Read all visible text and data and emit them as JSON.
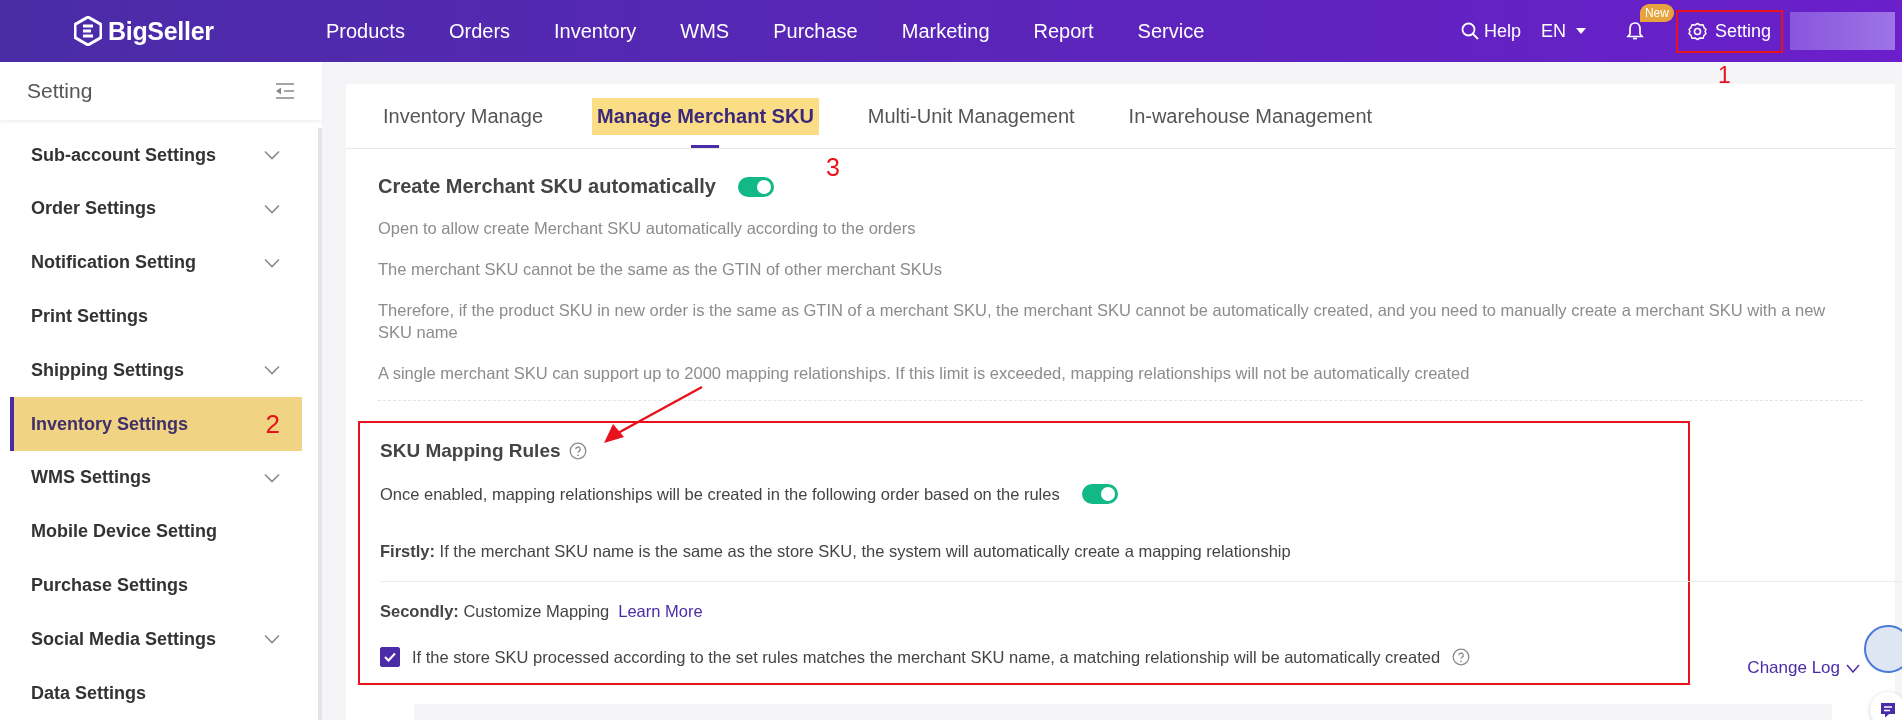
{
  "header": {
    "logo": "BigSeller",
    "nav": [
      "Products",
      "Orders",
      "Inventory",
      "WMS",
      "Purchase",
      "Marketing",
      "Report",
      "Service"
    ],
    "help": "Help",
    "language": "EN",
    "notification_badge": "New",
    "setting": {
      "label": "Setting",
      "highlighted": true,
      "annotation": "1"
    }
  },
  "sidebar": {
    "title": "Setting",
    "items": [
      {
        "label": "Sub-account Settings",
        "expandable": true,
        "selected": false
      },
      {
        "label": "Order Settings",
        "expandable": true,
        "selected": false
      },
      {
        "label": "Notification Setting",
        "expandable": true,
        "selected": false
      },
      {
        "label": "Print Settings",
        "expandable": false,
        "selected": false
      },
      {
        "label": "Shipping Settings",
        "expandable": true,
        "selected": false
      },
      {
        "label": "Inventory Settings",
        "expandable": false,
        "selected": true,
        "annotation": "2"
      },
      {
        "label": "WMS Settings",
        "expandable": true,
        "selected": false
      },
      {
        "label": "Mobile Device Setting",
        "expandable": false,
        "selected": false
      },
      {
        "label": "Purchase Settings",
        "expandable": false,
        "selected": false
      },
      {
        "label": "Social Media Settings",
        "expandable": true,
        "selected": false
      },
      {
        "label": "Data Settings",
        "expandable": false,
        "selected": false
      }
    ]
  },
  "tabs": [
    {
      "label": "Inventory Manage",
      "selected": false
    },
    {
      "label": "Manage Merchant SKU",
      "selected": true
    },
    {
      "label": "Multi-Unit Management",
      "selected": false
    },
    {
      "label": "In-warehouse Management",
      "selected": false
    }
  ],
  "auto_create": {
    "title": "Create Merchant SKU automatically",
    "on": true,
    "annotation": "3",
    "notes": [
      "Open to allow create Merchant SKU automatically according to the orders",
      "The merchant SKU cannot be the same as the GTIN of other merchant SKUs",
      "Therefore, if the product SKU in new order is the same as GTIN of a merchant SKU, the merchant SKU cannot be automatically created, and you need to manually create a merchant SKU with a new SKU name",
      "A single merchant SKU can support up to 2000 mapping relationships. If this limit is exceeded, mapping relationships will not be automatically created"
    ]
  },
  "mapping_rules": {
    "title": "SKU Mapping Rules",
    "highlighted": true,
    "pointer_arrow": true,
    "description": "Once enabled, mapping relationships will be created in the following order based on the rules",
    "on": true,
    "firstly": "**Firstly:** If the merchant SKU name is the same as the store SKU, the system will automatically create a mapping relationship",
    "secondly": "**Secondly:** Customize Mapping",
    "link": "Learn More",
    "option": {
      "label": "If the store SKU processed according to the set rules matches the merchant SKU name, a matching relationship will be automatically created",
      "checked": true
    }
  },
  "change_log": "Change Log"
}
